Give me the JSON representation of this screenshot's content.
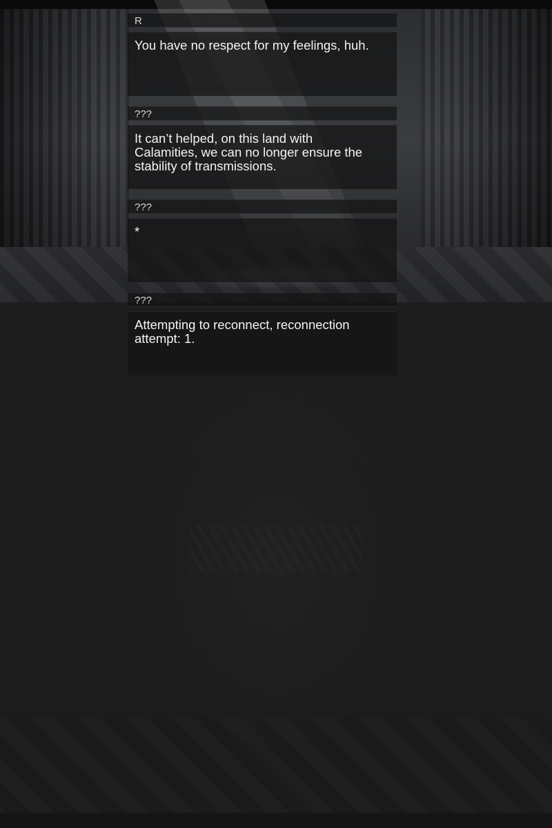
{
  "messages": [
    {
      "speaker": "R",
      "text": "You have no respect for my feelings, huh."
    },
    {
      "speaker": "???",
      "text": "It can’t helped, on this land with\nCalamities, we can no longer ensure the\nstability of transmissions."
    },
    {
      "speaker": "???",
      "text": "*"
    },
    {
      "speaker": "???",
      "text": "Attempting to reconnect, reconnection\nattempt: 1."
    }
  ]
}
